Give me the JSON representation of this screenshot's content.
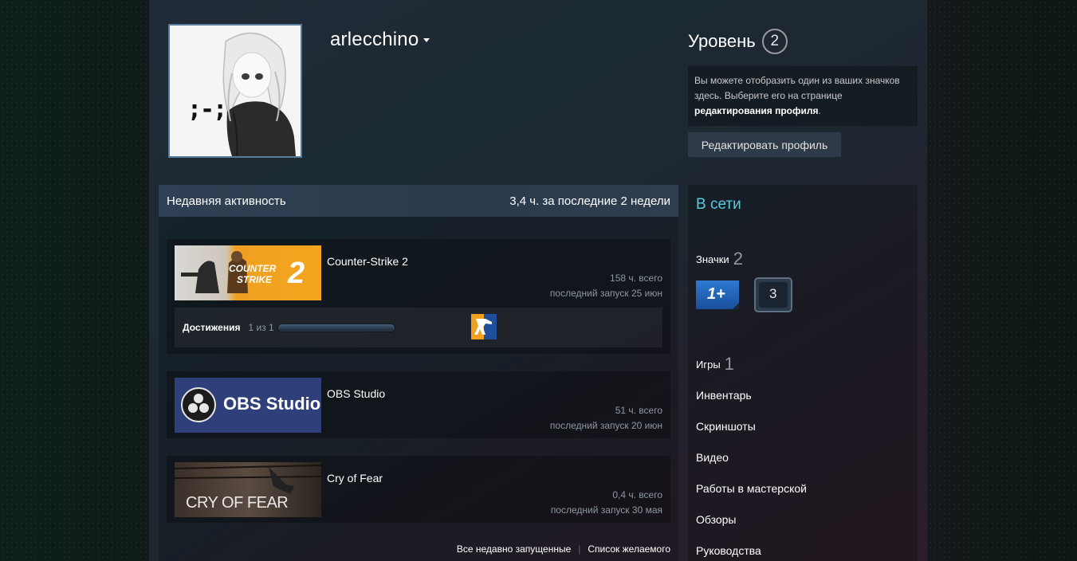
{
  "profile": {
    "persona_name": "arlecchino",
    "avatar_text": ";-;"
  },
  "level": {
    "title": "Уровень",
    "value": "2",
    "note_text": "Вы можете отобразить один из ваших значков здесь. Выберите его на странице ",
    "note_link": "редактирования профиля",
    "note_end": ".",
    "edit_button": "Редактировать профиль"
  },
  "recent": {
    "title": "Недавняя активность",
    "summary": "3,4 ч. за последние 2 недели",
    "games": [
      {
        "name": "Counter-Strike 2",
        "capsule_text_1": "COUNTER",
        "capsule_text_2": "STRIKE",
        "capsule_num": "2",
        "hours": "158 ч. всего",
        "last_played": "последний запуск 25 июн",
        "achievements_label": "Достижения",
        "achievements_count": "1 из 1",
        "achievement_progress": 1.0
      },
      {
        "name": "OBS Studio",
        "capsule_text": "OBS Studio",
        "hours": "51 ч. всего",
        "last_played": "последний запуск 20 июн"
      },
      {
        "name": "Cry of Fear",
        "capsule_text": "CRY OF FEAR",
        "hours": "0,4 ч. всего",
        "last_played": "последний запуск 30 мая"
      }
    ],
    "link_all": "Все недавно запущенные",
    "link_sep": "|",
    "link_wishlist": "Список желаемого"
  },
  "sidebar": {
    "status": "В сети",
    "badges_label": "Значки",
    "badges_count": "2",
    "badge1_text": "1+",
    "badge2_text": "3",
    "games_label": "Игры",
    "games_count": "1",
    "links": [
      "Инвентарь",
      "Скриншоты",
      "Видео",
      "Работы в мастерской",
      "Обзоры",
      "Руководства"
    ]
  },
  "colors": {
    "accent_online": "#57cbde",
    "muted_text": "#8f98a0",
    "cs2_orange": "#f0a020",
    "obs_blue": "#2f3f7a"
  }
}
